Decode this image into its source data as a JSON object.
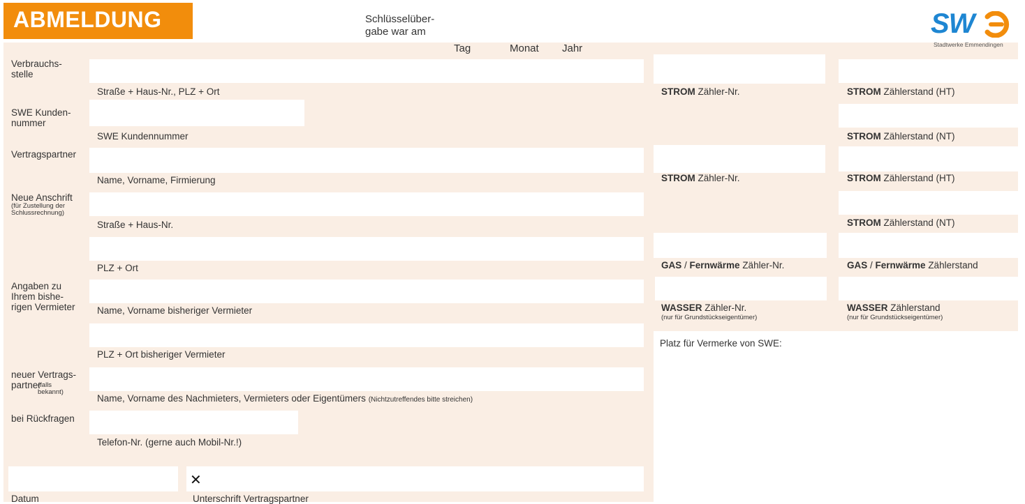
{
  "header": {
    "title": "ABMELDUNG",
    "key_handover_label": "Schlüsselüber-\ngabe war am",
    "day_label": "Tag",
    "month_label": "Monat",
    "year_label": "Jahr"
  },
  "logo": {
    "text": "SW",
    "subtitle": "Stadtwerke Emmendingen"
  },
  "left_form": {
    "consumption_site": {
      "label": "Verbrauchs-\nstelle",
      "hint": "Straße + Haus-Nr., PLZ + Ort"
    },
    "customer_number": {
      "label": "SWE Kunden-\nnummer",
      "hint": "SWE Kundennummer"
    },
    "contract_partner": {
      "label": "Vertragspartner",
      "hint": "Name, Vorname, Firmierung"
    },
    "new_address": {
      "label": "Neue Anschrift",
      "label_note": "(für Zustellung der\nSchlussrechnung)",
      "hint_street": "Straße + Haus-Nr.",
      "hint_city": "PLZ + Ort"
    },
    "landlord": {
      "label": "Angaben zu\nIhrem bishe-\nrigen Vermieter",
      "hint_name": "Name, Vorname bisheriger Vermieter",
      "hint_city": "PLZ + Ort bisheriger Vermieter"
    },
    "new_partner": {
      "label": "neuer Vertrags-\npartner",
      "label_note": "(falls\nbekannt)",
      "hint": "Name, Vorname des Nachmieters, Vermieters oder Eigentümers",
      "hint_note": "(Nichtzutreffendes bitte streichen)"
    },
    "phone": {
      "label": "bei Rückfragen",
      "hint": "Telefon-Nr. (gerne auch Mobil-Nr.!)"
    },
    "date_label": "Datum",
    "signature_label": "Unterschrift Vertragspartner",
    "signature_mark": "✕"
  },
  "meters": {
    "strom": "STROM",
    "meter_no": " Zähler-Nr.",
    "reading_ht": " Zählerstand (HT)",
    "reading_nt": " Zählerstand (NT)",
    "gas": "GAS",
    "slash": " / ",
    "fernwaerme": "Fernwärme",
    "gas_meter_no": " Zähler-Nr.",
    "gas_reading": " Zählerstand",
    "wasser": "WASSER",
    "water_meter_no": " Zähler-Nr.",
    "water_reading": " Zählerstand",
    "owner_note": "(nur für Grundstückseigentümer)",
    "remarks_label": "Platz für Vermerke von SWE:"
  },
  "colors": {
    "accent": "#f28d0c",
    "panel": "#faeee4",
    "logo_blue": "#1e86d2"
  }
}
